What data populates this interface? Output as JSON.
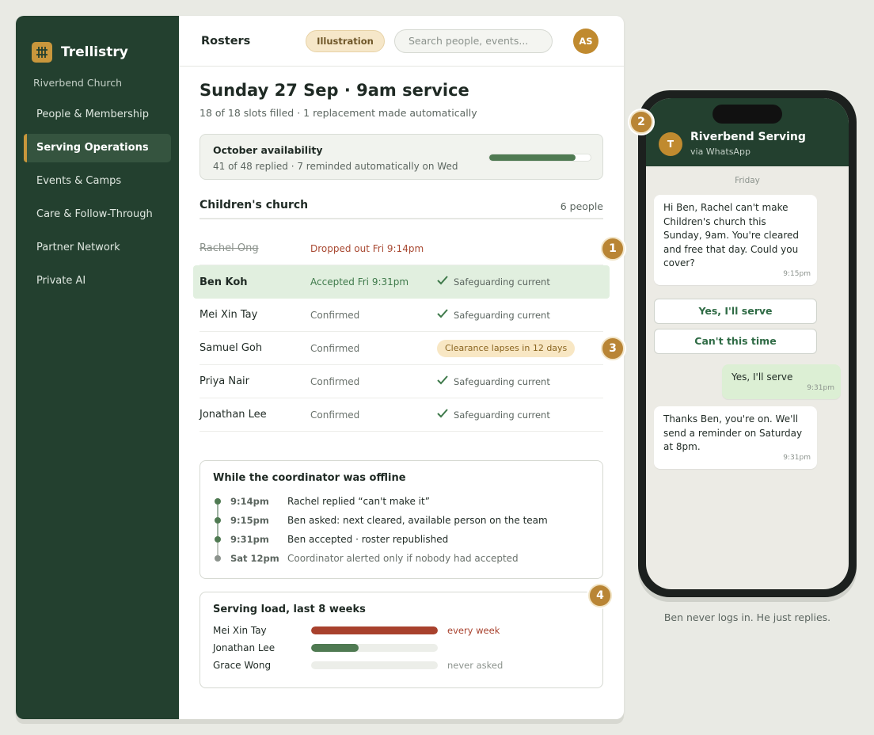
{
  "brand": {
    "name": "Trellistry"
  },
  "sidebar": {
    "org": "Riverbend Church",
    "items": [
      {
        "label": "People & Membership",
        "active": false
      },
      {
        "label": "Serving Operations",
        "active": true
      },
      {
        "label": "Events & Camps",
        "active": false
      },
      {
        "label": "Care & Follow-Through",
        "active": false
      },
      {
        "label": "Partner Network",
        "active": false
      },
      {
        "label": "Private AI",
        "active": false
      }
    ]
  },
  "topbar": {
    "title": "Rosters",
    "pill": "Illustration",
    "search_placeholder": "Search people, events...",
    "avatar_initials": "AS"
  },
  "page": {
    "title": "Sunday 27 Sep · 9am service",
    "subtitle": "18 of 18 slots filled · 1 replacement made automatically"
  },
  "availability": {
    "title": "October availability",
    "subtitle": "41 of 48 replied · 7 reminded automatically on Wed",
    "progress_fraction": 0.854
  },
  "roster": {
    "section_title": "Children's church",
    "count": "6 people",
    "rows": [
      {
        "name": "Rachel Ong",
        "status": "Dropped out Fri 9:14pm",
        "note": ""
      },
      {
        "name": "Ben Koh",
        "status": "Accepted Fri 9:31pm",
        "note": "Safeguarding current"
      },
      {
        "name": "Mei Xin Tay",
        "status": "Confirmed",
        "note": "Safeguarding current"
      },
      {
        "name": "Samuel Goh",
        "status": "Confirmed",
        "note": "Clearance lapses in 12 days"
      },
      {
        "name": "Priya Nair",
        "status": "Confirmed",
        "note": "Safeguarding current"
      },
      {
        "name": "Jonathan Lee",
        "status": "Confirmed",
        "note": "Safeguarding current"
      }
    ]
  },
  "callouts": [
    "1",
    "2",
    "3",
    "4"
  ],
  "offline": {
    "title": "While the coordinator was offline",
    "events": [
      {
        "time": "9:14pm",
        "text": "Rachel replied “can't make it”"
      },
      {
        "time": "9:15pm",
        "text": "Ben asked: next cleared, available person on the team"
      },
      {
        "time": "9:31pm",
        "text": "Ben accepted · roster republished"
      },
      {
        "time": "Sat 12pm",
        "text": "Coordinator alerted only if nobody had accepted"
      }
    ]
  },
  "load": {
    "title": "Serving load, last 8 weeks",
    "rows": [
      {
        "name": "Mei Xin Tay",
        "fraction": 1.0,
        "note": "every week",
        "color": "#a8412d"
      },
      {
        "name": "Jonathan Lee",
        "fraction": 0.375,
        "note": "",
        "color": "#4f7a52"
      },
      {
        "name": "Grace Wong",
        "fraction": 0.0,
        "note": "never asked",
        "color": "#8c938d"
      }
    ]
  },
  "phone": {
    "contact_initial": "T",
    "contact_name": "Riverbend Serving",
    "contact_sub": "via WhatsApp",
    "day": "Friday",
    "msg1": {
      "text": "Hi Ben, Rachel can't make Children's church this Sunday, 9am. You're cleared and free that day. Could you cover?",
      "time": "9:15pm"
    },
    "btn_yes": "Yes, I'll serve",
    "btn_no": "Can't this time",
    "reply": {
      "text": "Yes, I'll serve",
      "time": "9:31pm"
    },
    "msg2": {
      "text": "Thanks Ben, you're on. We'll send a reminder on Saturday at 8pm.",
      "time": "9:31pm"
    },
    "caption": "Ben never logs in. He just replies."
  },
  "colors": {
    "sidebar_bg": "#23402f",
    "accent_gold": "#c9973c",
    "success_green": "#4f7a52",
    "alert_red": "#a8412d"
  }
}
